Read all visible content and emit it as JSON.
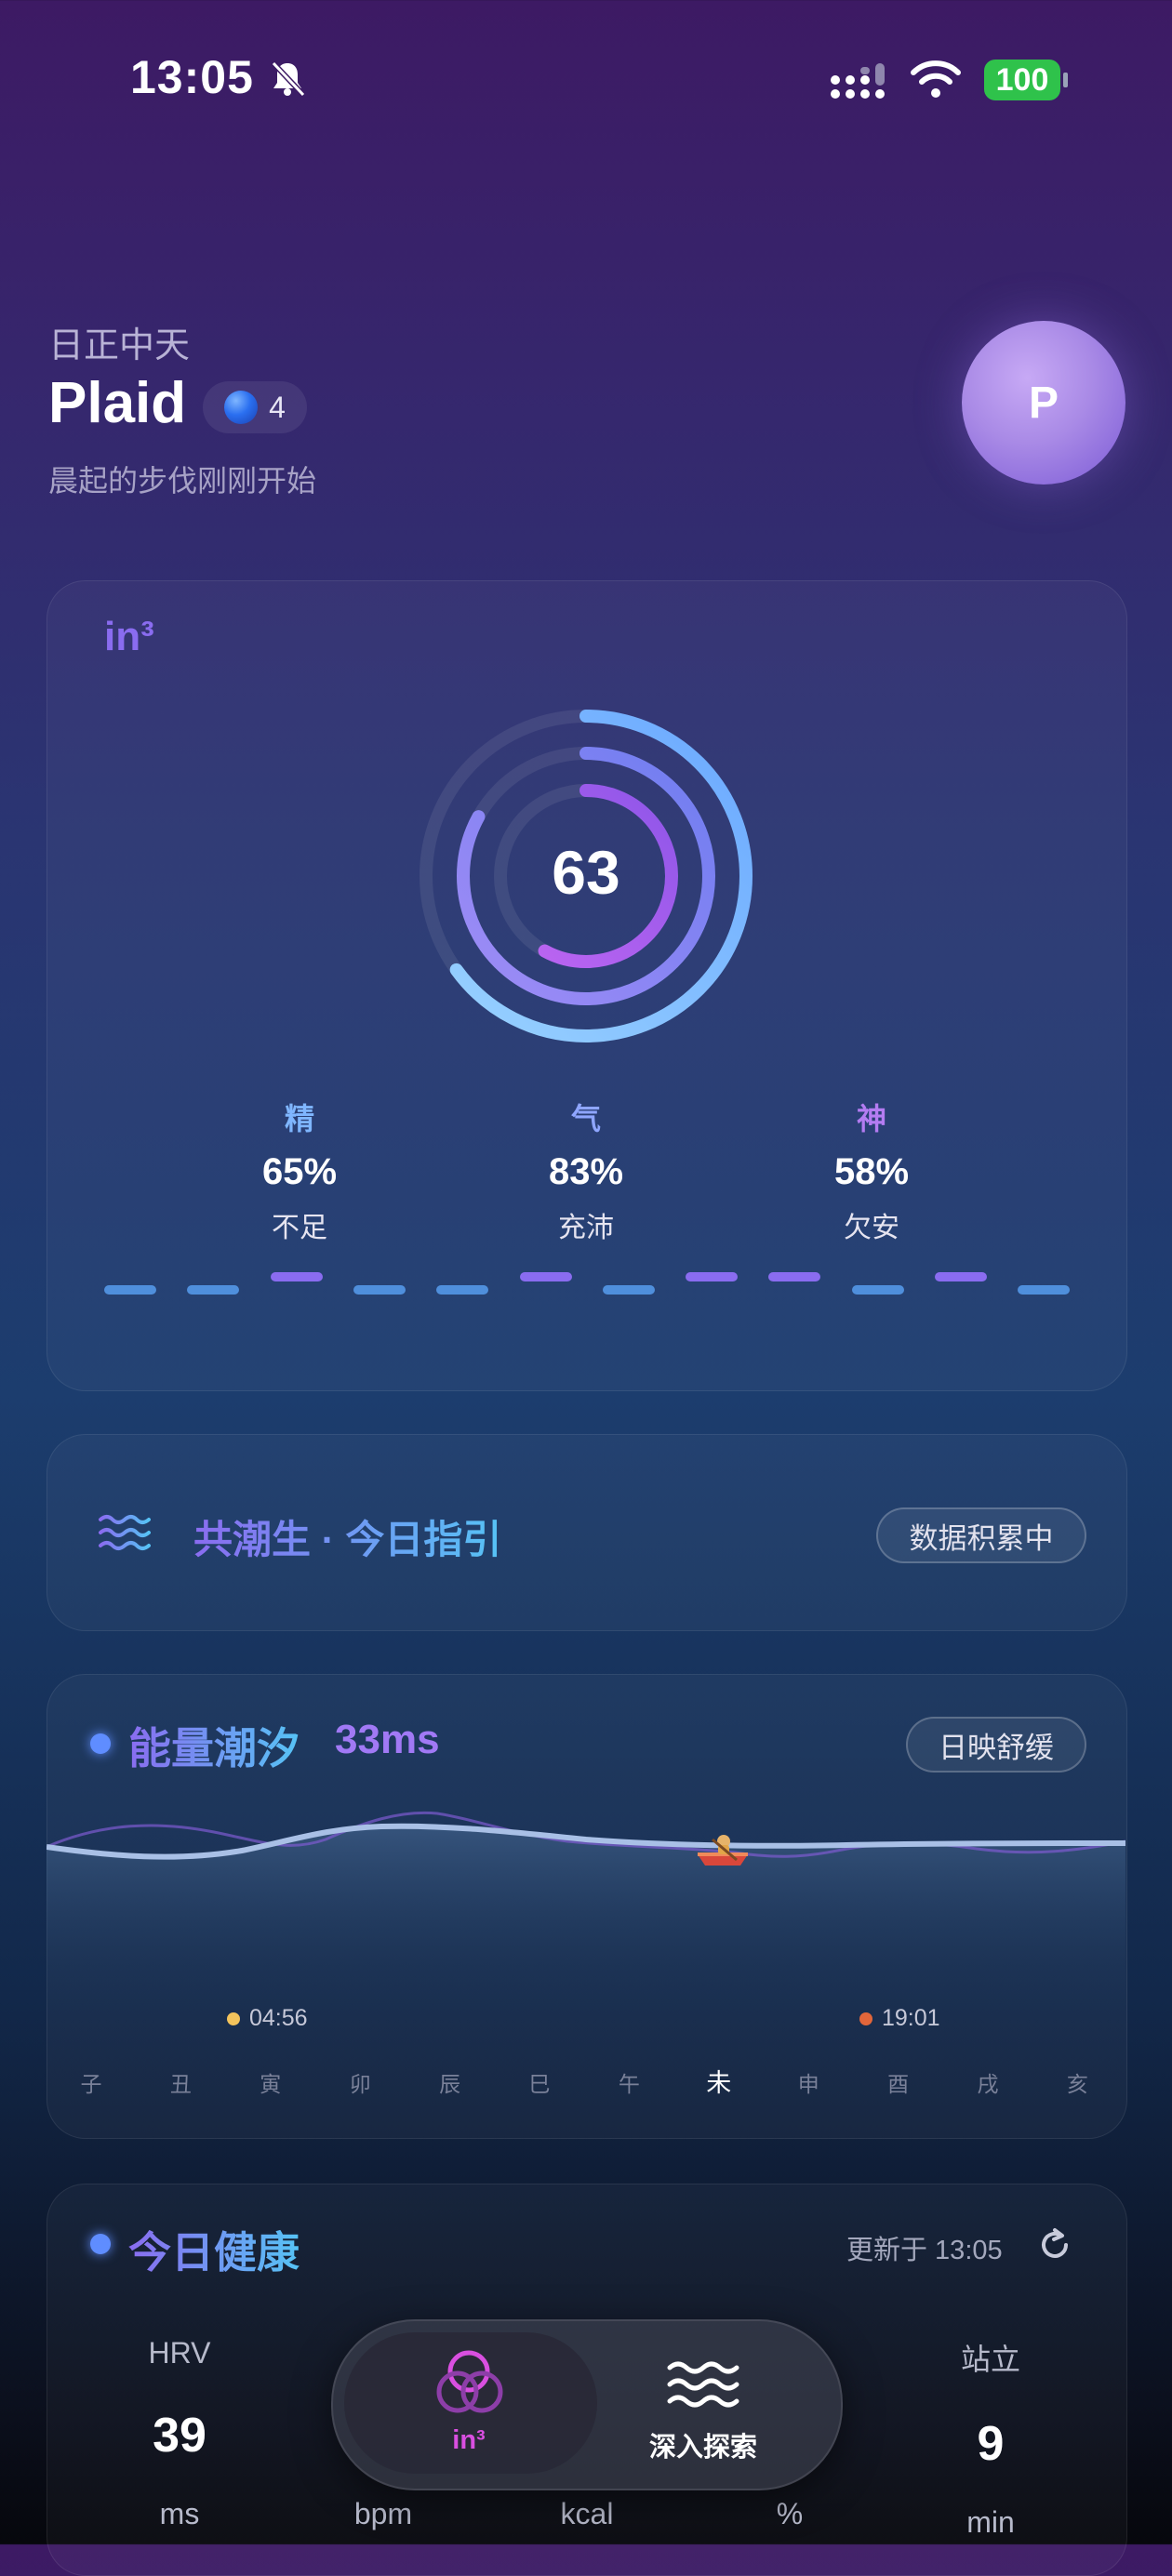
{
  "status_bar": {
    "time": "13:05",
    "battery": "100"
  },
  "header": {
    "greeting": "日正中天",
    "user_name": "Plaid",
    "level": "4",
    "subtitle": "晨起的步伐刚刚开始",
    "avatar_initial": "P"
  },
  "score_card": {
    "logo": "in³",
    "score": "63",
    "metrics": [
      {
        "name": "精",
        "value": "65%",
        "desc": "不足",
        "fraction": 0.65
      },
      {
        "name": "气",
        "value": "83%",
        "desc": "充沛",
        "fraction": 0.83
      },
      {
        "name": "神",
        "value": "58%",
        "desc": "欠安",
        "fraction": 0.58
      }
    ]
  },
  "guide_card": {
    "title": "共潮生 · 今日指引",
    "status": "数据积累中"
  },
  "tide_card": {
    "title": "能量潮汐",
    "value": "33ms",
    "badge": "日映舒缓",
    "sunrise": "04:56",
    "sunset": "19:01",
    "hours": [
      "子",
      "丑",
      "寅",
      "卯",
      "辰",
      "巳",
      "午",
      "未",
      "申",
      "酉",
      "戌",
      "亥"
    ],
    "current_hour": "未"
  },
  "health_card": {
    "title": "今日健康",
    "updated": "更新于 13:05",
    "metrics": [
      {
        "label": "HRV",
        "value": "39",
        "unit": "ms"
      },
      {
        "label": "",
        "value": "",
        "unit": "bpm"
      },
      {
        "label": "",
        "value": "",
        "unit": "kcal"
      },
      {
        "label": "",
        "value": "",
        "unit": "%"
      },
      {
        "label": "站立",
        "value": "9",
        "unit": "min"
      }
    ]
  },
  "tab_bar": {
    "tab1": "in³",
    "tab2": "深入探索"
  },
  "colors": {
    "accent_purple": "#8a6cf0",
    "accent_blue": "#56c3f5",
    "battery_green": "#2fc24b"
  }
}
